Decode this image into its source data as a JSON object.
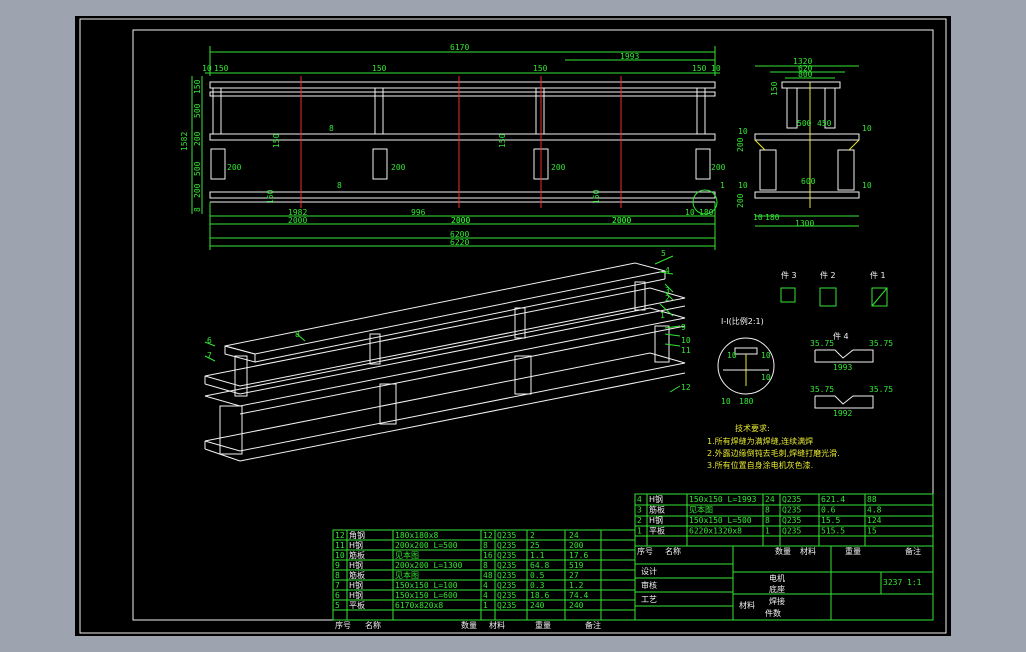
{
  "plan": {
    "overall_top": "6170",
    "right_span": "1993",
    "end_dims": [
      "10",
      "150",
      "150",
      "150",
      "150",
      "10"
    ],
    "left_dims": [
      "1582",
      "150",
      "500",
      "200",
      "500",
      "200",
      "8"
    ],
    "bottom_row1": [
      "1982",
      "996",
      "2000",
      "2000",
      "10",
      "180"
    ],
    "bottom_row2": [
      "2000",
      "2000",
      "2000"
    ],
    "bottom_total1": "6200",
    "bottom_total2": "6220",
    "inner_labels": [
      "200",
      "200",
      "200",
      "200",
      "8",
      "8",
      "150",
      "150",
      "150",
      "150"
    ],
    "callout": "1"
  },
  "side_view": {
    "dims_top": [
      "1320",
      "620",
      "800",
      "150"
    ],
    "dims_mid": [
      "500",
      "450",
      "600"
    ],
    "dims_side": [
      "10",
      "10",
      "10",
      "10",
      "200",
      "200"
    ],
    "dims_bottom": [
      "10",
      "180",
      "1300"
    ]
  },
  "iso_view": {
    "callouts": [
      "5",
      "4",
      "3",
      "2",
      "1",
      "6",
      "7",
      "8",
      "9",
      "10",
      "11",
      "12"
    ]
  },
  "details": {
    "part_labels": [
      "件 3",
      "件 2",
      "件 1"
    ],
    "section_label": "I-I(比例2:1)",
    "section_dims": [
      "10",
      "10",
      "10",
      "180",
      "10"
    ],
    "piece4_label": "件 4",
    "piece4_dims": [
      "35.75",
      "35.75",
      "1993"
    ],
    "piece5_dims": [
      "35.75",
      "35.75",
      "1992"
    ]
  },
  "tech_notes": {
    "title": "技术要求:",
    "lines": [
      "1.所有焊缝为满焊缝,连续满焊",
      "2.外露边缘倒钝去毛刺,焊缝打磨光滑.",
      "3.所有位置自身涂电机灰色漆."
    ]
  },
  "parts_top": {
    "rows": [
      [
        "4",
        "H钢",
        "150x150 L=1993",
        "24",
        "Q235",
        "621.4",
        "88"
      ],
      [
        "3",
        "筋板",
        "见本图",
        "8",
        "Q235",
        "0.6",
        "4.8"
      ],
      [
        "2",
        "H钢",
        "150x150 L=500",
        "8",
        "Q235",
        "15.5",
        "124"
      ],
      [
        "1",
        "平板",
        "6220x1320x8",
        "1",
        "Q235",
        "515.5",
        "15"
      ]
    ],
    "header": [
      "序号",
      "名称",
      "数量",
      "材料",
      "重量",
      "备注"
    ]
  },
  "parts_bottom": {
    "rows": [
      [
        "12",
        "角钢",
        "180x180x8",
        "12",
        "Q235",
        "2",
        "24"
      ],
      [
        "11",
        "H钢",
        "200x200 L=500",
        "8",
        "Q235",
        "25",
        "200"
      ],
      [
        "10",
        "筋板",
        "见本图",
        "16",
        "Q235",
        "1.1",
        "17.6"
      ],
      [
        "9",
        "H钢",
        "200x200 L=1300",
        "8",
        "Q235",
        "64.8",
        "519"
      ],
      [
        "8",
        "筋板",
        "见本图",
        "48",
        "Q235",
        "0.5",
        "27"
      ],
      [
        "7",
        "H钢",
        "150x150 L=100",
        "4",
        "Q235",
        "0.3",
        "1.2"
      ],
      [
        "6",
        "H钢",
        "150x150 L=600",
        "4",
        "Q235",
        "18.6",
        "74.4"
      ],
      [
        "5",
        "平板",
        "6170x820x8",
        "1",
        "Q235",
        "240",
        "240"
      ]
    ],
    "header": [
      "序号",
      "名称",
      "数量",
      "材料",
      "重量",
      "备注"
    ]
  },
  "title_block": {
    "name_line1": "电机",
    "name_line2": "底座",
    "scale_block": "3237",
    "scale_ratio": "1:1",
    "labels": [
      "设计",
      "审核",
      "工艺",
      "材料",
      "件数",
      "焊接"
    ]
  }
}
